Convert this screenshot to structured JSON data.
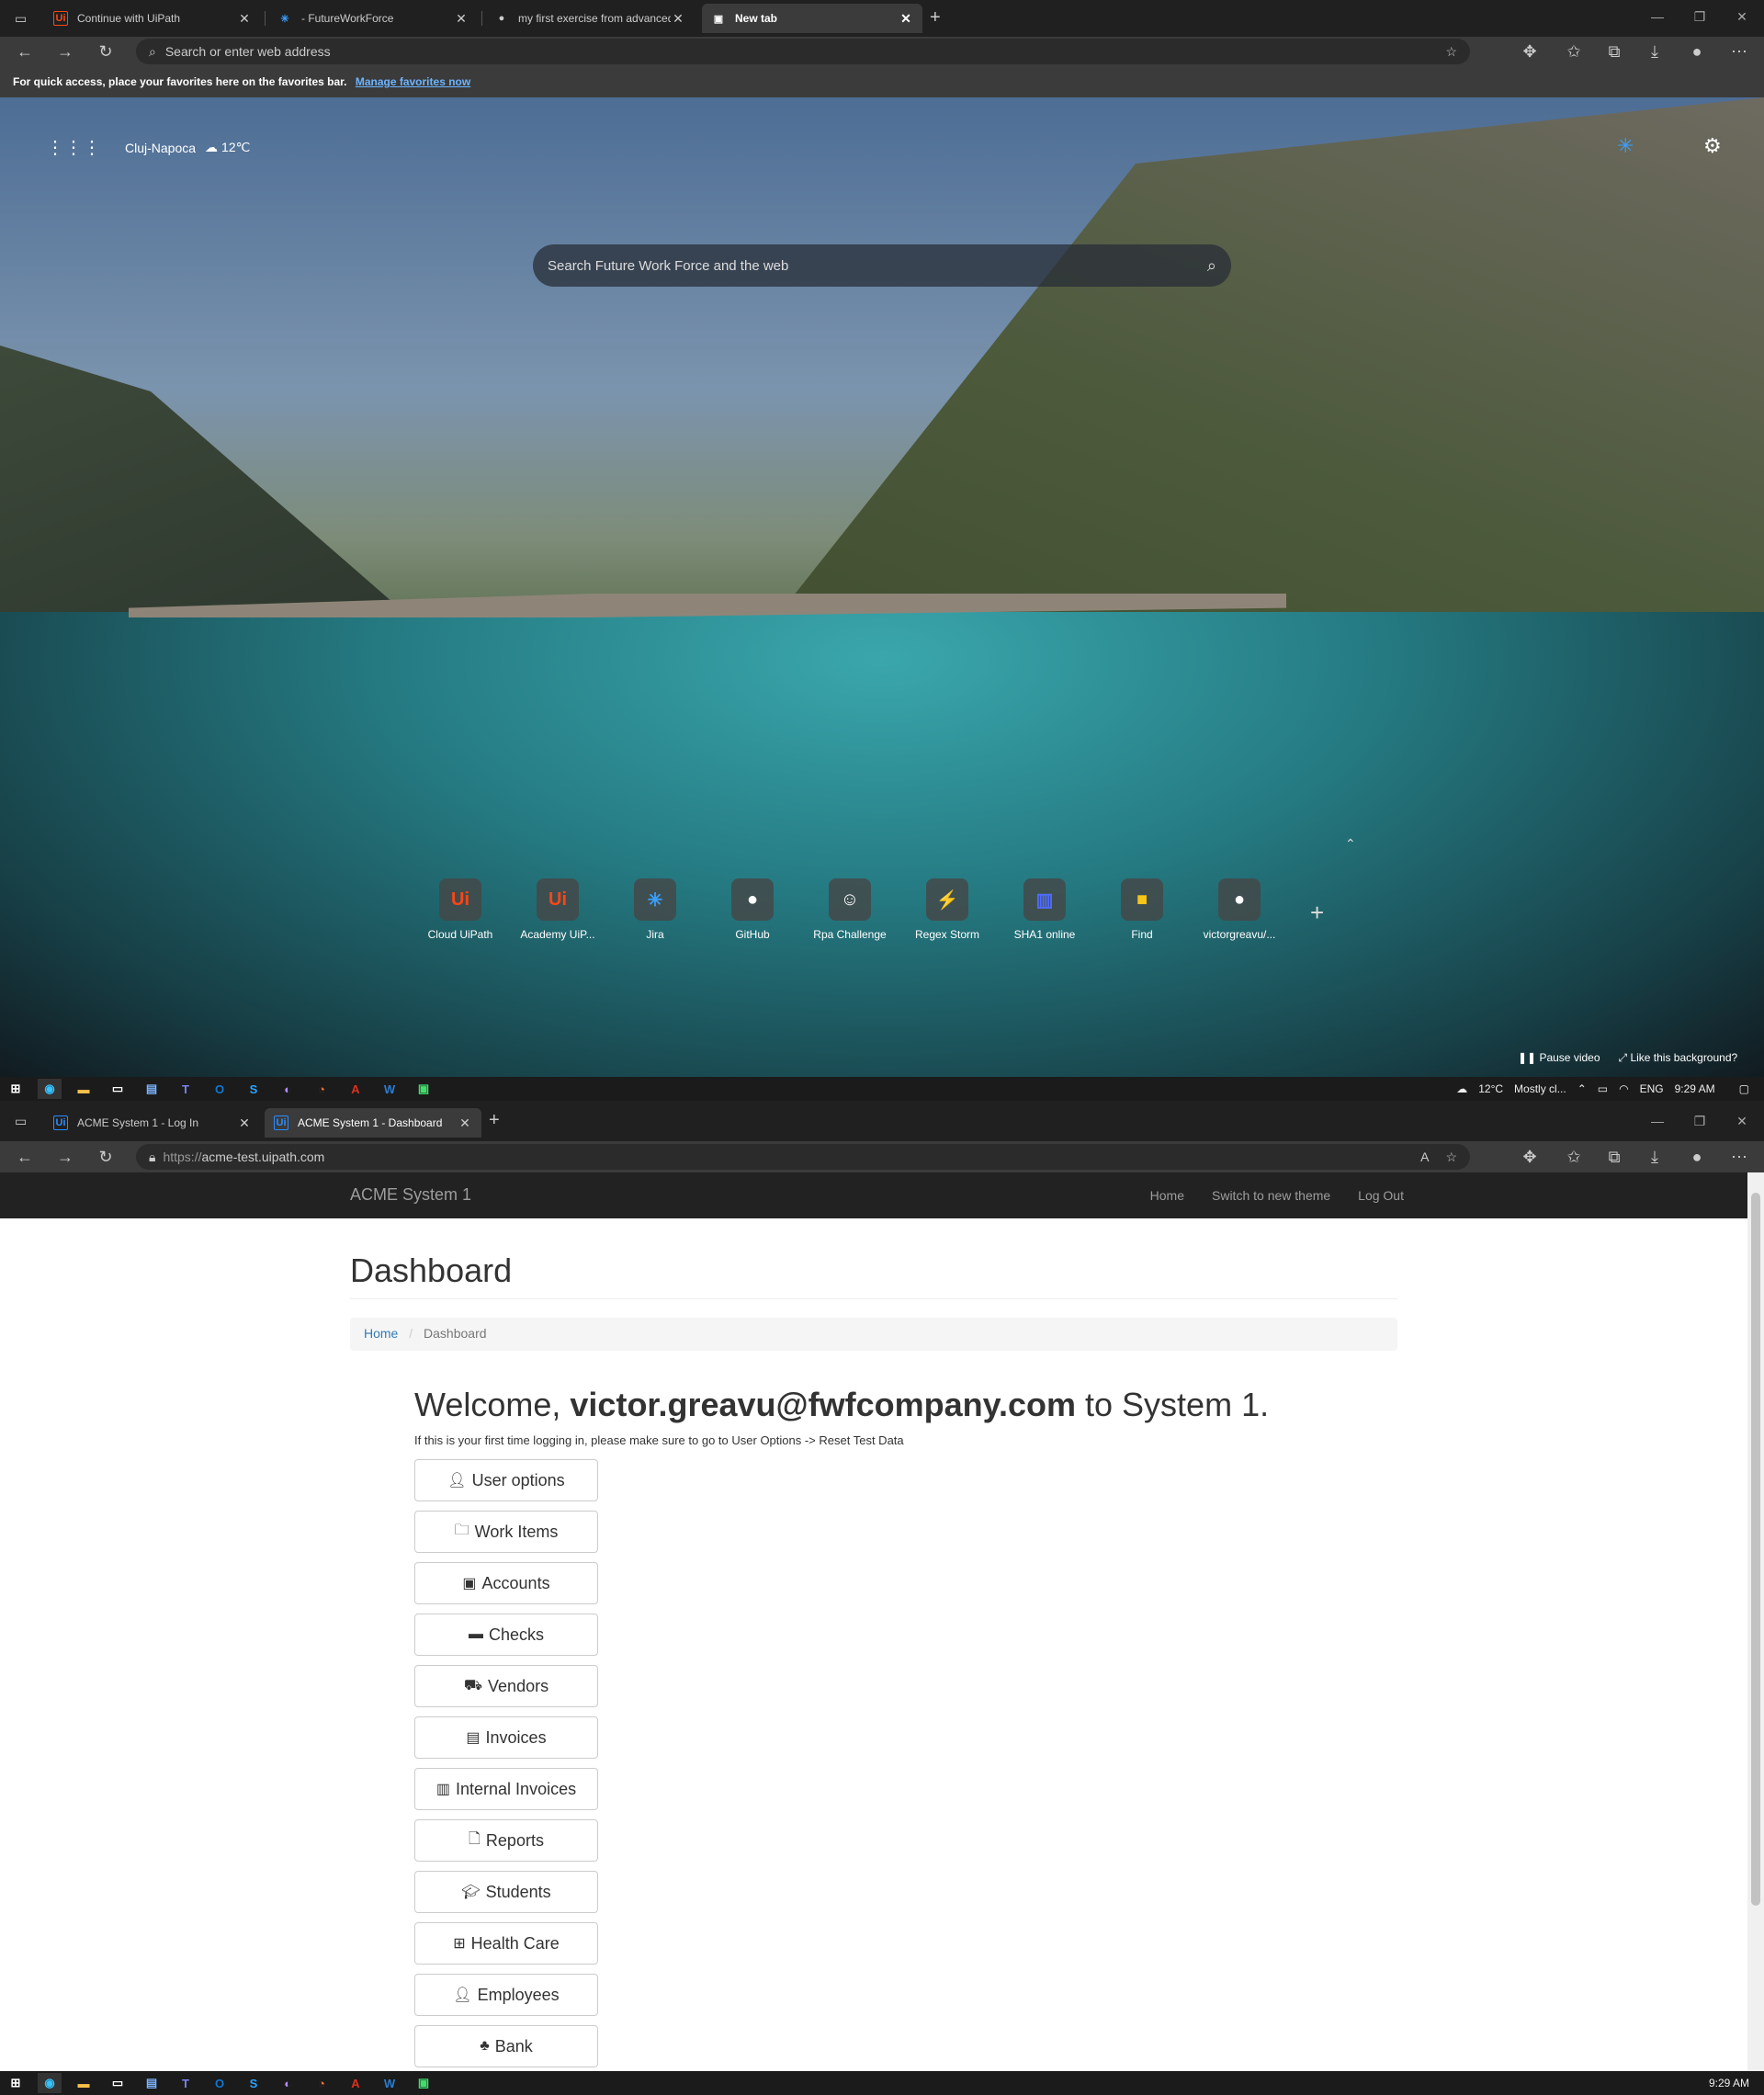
{
  "top_browser": {
    "tabs": [
      {
        "title": "Continue with UiPath",
        "favicon": "uipath-icon"
      },
      {
        "title": "- FutureWorkForce",
        "favicon": "fwf-icon"
      },
      {
        "title": "my first exercise from advanced",
        "favicon": "github-icon"
      },
      {
        "title": "New tab",
        "favicon": "newtab-icon"
      }
    ],
    "address_placeholder": "Search or enter web address",
    "favorites_bar_text": "For quick access, place your favorites here on the favorites bar.",
    "favorites_bar_link": "Manage favorites now",
    "weather": {
      "city": "Cluj-Napoca",
      "temp": "12℃"
    },
    "search_placeholder": "Search Future Work Force and the web",
    "quick_links": [
      {
        "label": "Cloud UiPath",
        "icon": "uipath-icon"
      },
      {
        "label": "Academy UiP...",
        "icon": "uipath-icon"
      },
      {
        "label": "Jira",
        "icon": "fwf-icon"
      },
      {
        "label": "GitHub",
        "icon": "github-icon"
      },
      {
        "label": "Rpa Challenge",
        "icon": "robot-icon"
      },
      {
        "label": "Regex Storm",
        "icon": "storm-icon"
      },
      {
        "label": "SHA1 online",
        "icon": "sha1-icon"
      },
      {
        "label": "Find",
        "icon": "imdb-icon"
      },
      {
        "label": "victorgreavu/...",
        "icon": "github-icon"
      }
    ],
    "pause_video": "Pause video",
    "like_background": "Like this background?"
  },
  "taskbar": {
    "weather": "12°C",
    "weather_desc": "Mostly cl...",
    "lang": "ENG",
    "time": "9:29 AM"
  },
  "bottom_browser": {
    "tabs": [
      {
        "title": "ACME System 1 - Log In"
      },
      {
        "title": "ACME System 1 - Dashboard"
      }
    ],
    "url_prefix": "https://",
    "url_host": "acme-test.uipath.com"
  },
  "acme": {
    "brand": "ACME System 1",
    "menu": [
      "Home",
      "Switch to new theme",
      "Log Out"
    ],
    "page_title": "Dashboard",
    "breadcrumb": {
      "home": "Home",
      "current": "Dashboard"
    },
    "welcome_prefix": "Welcome,",
    "welcome_user": "victor.greavu@fwfcompany.com",
    "welcome_suffix": "to System 1.",
    "hint": "If this is your first time logging in, please make sure to go to User Options -> Reset Test Data",
    "buttons": [
      {
        "label": "User options",
        "icon": "user-icon"
      },
      {
        "label": "Work Items",
        "icon": "folder-icon"
      },
      {
        "label": "Accounts",
        "icon": "money-icon"
      },
      {
        "label": "Checks",
        "icon": "credit-card-icon"
      },
      {
        "label": "Vendors",
        "icon": "truck-icon"
      },
      {
        "label": "Invoices",
        "icon": "file-text-icon"
      },
      {
        "label": "Internal Invoices",
        "icon": "file-icon"
      },
      {
        "label": "Reports",
        "icon": "document-icon"
      },
      {
        "label": "Students",
        "icon": "graduation-cap-icon"
      },
      {
        "label": "Health Care",
        "icon": "medkit-icon"
      },
      {
        "label": "Employees",
        "icon": "employee-icon"
      },
      {
        "label": "Bank",
        "icon": "piggy-bank-icon"
      }
    ]
  }
}
